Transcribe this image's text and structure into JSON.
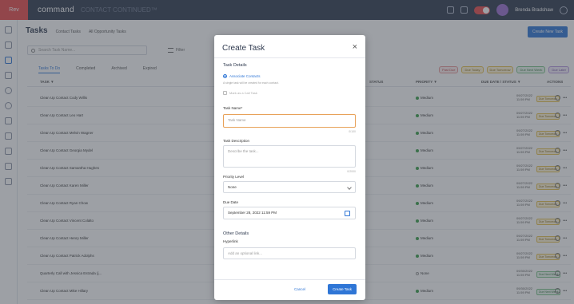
{
  "topbar": {
    "brand_badge": "Rev",
    "brand": "command",
    "brand_sub": "CONTACT  CONTINUED™",
    "user_name": "Brenda Bradshaw"
  },
  "page": {
    "title": "Tasks",
    "tabs": [
      "Contact Tasks",
      "All Opportunity Tasks"
    ],
    "create_button": "Create New Task",
    "search_placeholder": "Search Task Name...",
    "filter_label": "Filter",
    "state_tabs": [
      "Tasks To Do",
      "Completed",
      "Archived",
      "Expired"
    ],
    "legend": [
      {
        "label": "Past Due",
        "tone": "red"
      },
      {
        "label": "Due Today",
        "tone": "yellow"
      },
      {
        "label": "Due Tomorrow",
        "tone": "yellow"
      },
      {
        "label": "Due Next Week",
        "tone": "green"
      },
      {
        "label": "Due Later",
        "tone": "purple"
      }
    ],
    "columns": {
      "title": "TASK ▼",
      "status": "STATUS",
      "priority": "PRIORITY ▼",
      "due": "DUE DATE / STATUS ▼",
      "actions": "ACTIONS"
    }
  },
  "rows": [
    {
      "name": "Clean Up Contact Cody Willis",
      "priority": "Medium",
      "date": "09/27/2022",
      "time": "11:59 PM",
      "status": "Due Tomorrow",
      "tone": "due"
    },
    {
      "name": "Clean Up Contact Leo Hart",
      "priority": "Medium",
      "date": "09/27/2022",
      "time": "11:59 PM",
      "status": "Due Tomorrow",
      "tone": "due"
    },
    {
      "name": "Clean Up Contact Melvin Wagner",
      "priority": "Medium",
      "date": "09/27/2022",
      "time": "11:59 PM",
      "status": "Due Tomorrow",
      "tone": "due"
    },
    {
      "name": "Clean Up Contact Georgia Mydel",
      "priority": "Medium",
      "date": "09/27/2022",
      "time": "11:59 PM",
      "status": "Due Tomorrow",
      "tone": "due"
    },
    {
      "name": "Clean Up Contact Samantha Hughes",
      "priority": "Medium",
      "date": "09/27/2022",
      "time": "11:59 PM",
      "status": "Due Tomorrow",
      "tone": "due"
    },
    {
      "name": "Clean Up Contact Karen Miller",
      "priority": "Medium",
      "date": "09/27/2022",
      "time": "11:59 PM",
      "status": "Due Tomorrow",
      "tone": "due"
    },
    {
      "name": "Clean Up Contact Ryan Chow",
      "priority": "Medium",
      "date": "09/27/2022",
      "time": "11:59 PM",
      "status": "Due Tomorrow",
      "tone": "due"
    },
    {
      "name": "Clean Up Contact Vincent Colalto",
      "priority": "Medium",
      "date": "09/27/2022",
      "time": "11:59 PM",
      "status": "Due Tomorrow",
      "tone": "due"
    },
    {
      "name": "Clean Up Contact Henry Miller",
      "priority": "Medium",
      "date": "09/27/2022",
      "time": "11:59 PM",
      "status": "Due Tomorrow",
      "tone": "due"
    },
    {
      "name": "Clean Up Contact Patrick Adolphs",
      "priority": "Medium",
      "date": "09/27/2022",
      "time": "11:59 PM",
      "status": "Due Tomorrow",
      "tone": "due"
    },
    {
      "name": "Quarterly Call with Jessica Estrada (j...",
      "priority": "None",
      "date": "09/30/2022",
      "time": "11:59 PM",
      "status": "Due Next Week",
      "tone": "notdue"
    },
    {
      "name": "Clean Up Contact Mike Hillary",
      "priority": "Medium",
      "date": "09/30/2022",
      "time": "11:59 PM",
      "status": "Due Next Week",
      "tone": "notdue"
    }
  ],
  "modal": {
    "title": "Create Task",
    "close": "×",
    "details_heading": "Task Details",
    "associate_label": "Associate Contacts",
    "associate_hint": "A single task will be created for each contact.",
    "call_task_label": "Mark as a Call Task",
    "name_label": "Task Name*",
    "name_placeholder": "Task Name",
    "name_count": "0/100",
    "desc_label": "Task Description",
    "desc_placeholder": "Describe the task...",
    "desc_count": "0/2000",
    "priority_label": "Priority Level",
    "priority_value": "None",
    "due_label": "Due Date",
    "due_value": "September 28, 2022 11:59 PM",
    "other_heading": "Other Details",
    "hyperlink_label": "Hyperlink",
    "hyperlink_placeholder": "Add an optional link...",
    "cancel": "Cancel",
    "create": "Create Task"
  }
}
